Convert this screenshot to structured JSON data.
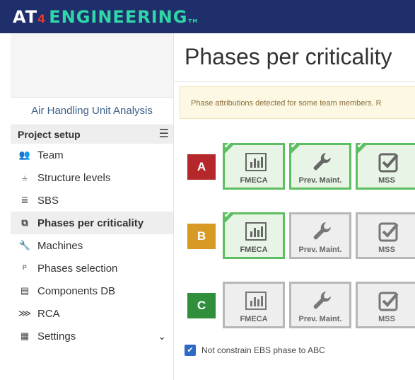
{
  "brand": {
    "part1": "AT",
    "part2": "4",
    "part3": "ENGINEERING",
    "tm": "TM"
  },
  "sidebar": {
    "project_name": "Air Handling Unit Analysis",
    "section_title": "Project setup",
    "items": [
      {
        "label": "Team",
        "icon": "team-icon",
        "glyph": "👥"
      },
      {
        "label": "Structure levels",
        "icon": "structure-levels-icon",
        "glyph": "⫨"
      },
      {
        "label": "SBS",
        "icon": "database-icon",
        "glyph": "≣"
      },
      {
        "label": "Phases per criticality",
        "icon": "cubes-icon",
        "glyph": "⧉"
      },
      {
        "label": "Machines",
        "icon": "wrench-icon",
        "glyph": "🔧"
      },
      {
        "label": "Phases selection",
        "icon": "phases-icon",
        "glyph": "ᴾ"
      },
      {
        "label": "Components DB",
        "icon": "components-icon",
        "glyph": "▤"
      },
      {
        "label": "RCA",
        "icon": "rca-icon",
        "glyph": "⋙"
      },
      {
        "label": "Settings",
        "icon": "settings-icon",
        "glyph": "▦"
      }
    ]
  },
  "main": {
    "title": "Phases per criticality",
    "alert": "Phase attributions detected for some team members. R",
    "rows": [
      {
        "level": "A",
        "color": "#b4282b",
        "cards": [
          {
            "label": "FMECA",
            "active": true
          },
          {
            "label": "Prev. Maint.",
            "active": true
          },
          {
            "label": "MSS",
            "active": true
          }
        ]
      },
      {
        "level": "B",
        "color": "#d89a25",
        "cards": [
          {
            "label": "FMECA",
            "active": true
          },
          {
            "label": "Prev. Maint.",
            "active": false
          },
          {
            "label": "MSS",
            "active": false
          }
        ]
      },
      {
        "level": "C",
        "color": "#2f8f3a",
        "cards": [
          {
            "label": "FMECA",
            "active": false
          },
          {
            "label": "Prev. Maint.",
            "active": false
          },
          {
            "label": "MSS",
            "active": false
          }
        ]
      }
    ],
    "checkbox_label": "Not constrain EBS phase to ABC",
    "checkbox_checked": true
  }
}
